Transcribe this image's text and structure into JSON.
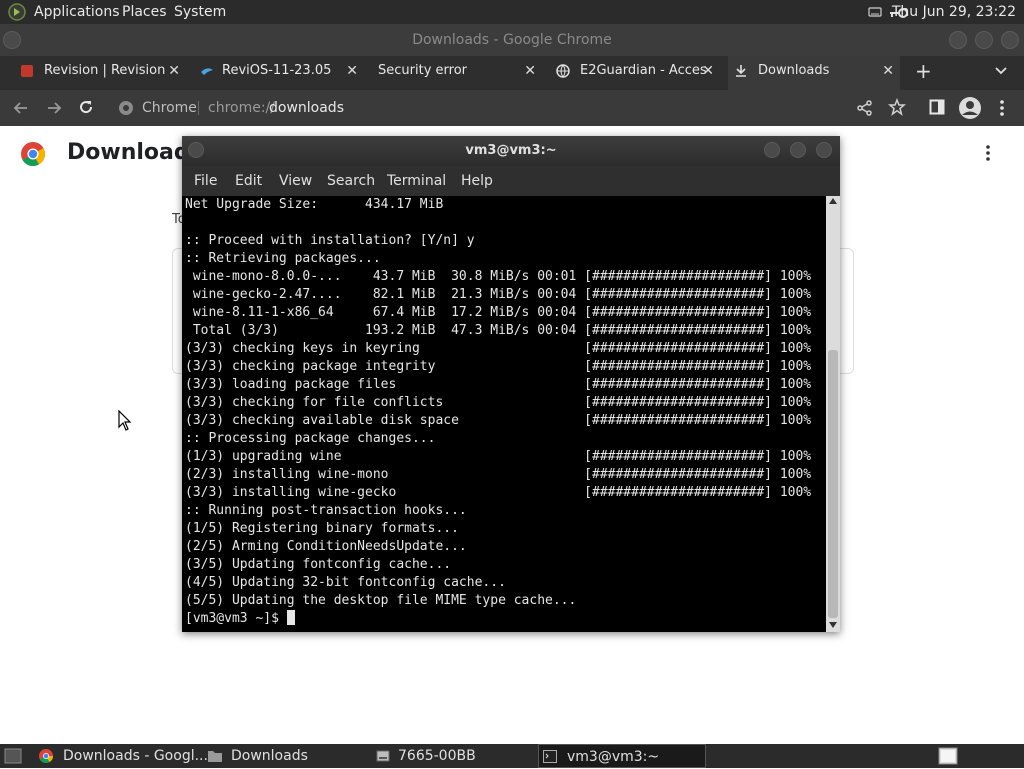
{
  "top_panel": {
    "menus": [
      "Applications",
      "Places",
      "System"
    ],
    "clock": "Thu Jun 29, 23:22"
  },
  "chrome": {
    "window_title": "Downloads - Google Chrome",
    "tabs": [
      {
        "label": "Revision | Revision",
        "close": "✕"
      },
      {
        "label": "ReviOS-11-23.05",
        "close": "✕"
      },
      {
        "label": "Security error",
        "close": "✕"
      },
      {
        "label": "E2Guardian - Acces",
        "close": "✕"
      },
      {
        "label": "Downloads",
        "close": "✕"
      }
    ],
    "new_tab": "+",
    "omnibox": {
      "site": "Chrome",
      "url_prefix": "chrome://",
      "url_path": "downloads"
    }
  },
  "downloads_page": {
    "title": "Downloads",
    "section_label": "To"
  },
  "terminal": {
    "title": "vm3@vm3:~",
    "menu": [
      "File",
      "Edit",
      "View",
      "Search",
      "Terminal",
      "Help"
    ],
    "lines": [
      "Net Upgrade Size:      434.17 MiB",
      "",
      ":: Proceed with installation? [Y/n] y",
      ":: Retrieving packages...",
      " wine-mono-8.0.0-...    43.7 MiB  30.8 MiB/s 00:01 [######################] 100%",
      " wine-gecko-2.47....    82.1 MiB  21.3 MiB/s 00:04 [######################] 100%",
      " wine-8.11-1-x86_64     67.4 MiB  17.2 MiB/s 00:04 [######################] 100%",
      " Total (3/3)           193.2 MiB  47.3 MiB/s 00:04 [######################] 100%",
      "(3/3) checking keys in keyring                     [######################] 100%",
      "(3/3) checking package integrity                   [######################] 100%",
      "(3/3) loading package files                        [######################] 100%",
      "(3/3) checking for file conflicts                  [######################] 100%",
      "(3/3) checking available disk space                [######################] 100%",
      ":: Processing package changes...",
      "(1/3) upgrading wine                               [######################] 100%",
      "(2/3) installing wine-mono                         [######################] 100%",
      "(3/3) installing wine-gecko                        [######################] 100%",
      ":: Running post-transaction hooks...",
      "(1/5) Registering binary formats...",
      "(2/5) Arming ConditionNeedsUpdate...",
      "(3/5) Updating fontconfig cache...",
      "(4/5) Updating 32-bit fontconfig cache...",
      "(5/5) Updating the desktop file MIME type cache..."
    ],
    "prompt": "[vm3@vm3 ~]$ "
  },
  "taskbar": {
    "items": [
      {
        "label": "Downloads - Googl...",
        "icon": "chrome-icon"
      },
      {
        "label": "Downloads",
        "icon": "folder-icon"
      },
      {
        "label": "7665-00BB",
        "icon": "drive-icon"
      },
      {
        "label": "vm3@vm3:~",
        "icon": "terminal-icon"
      }
    ]
  }
}
